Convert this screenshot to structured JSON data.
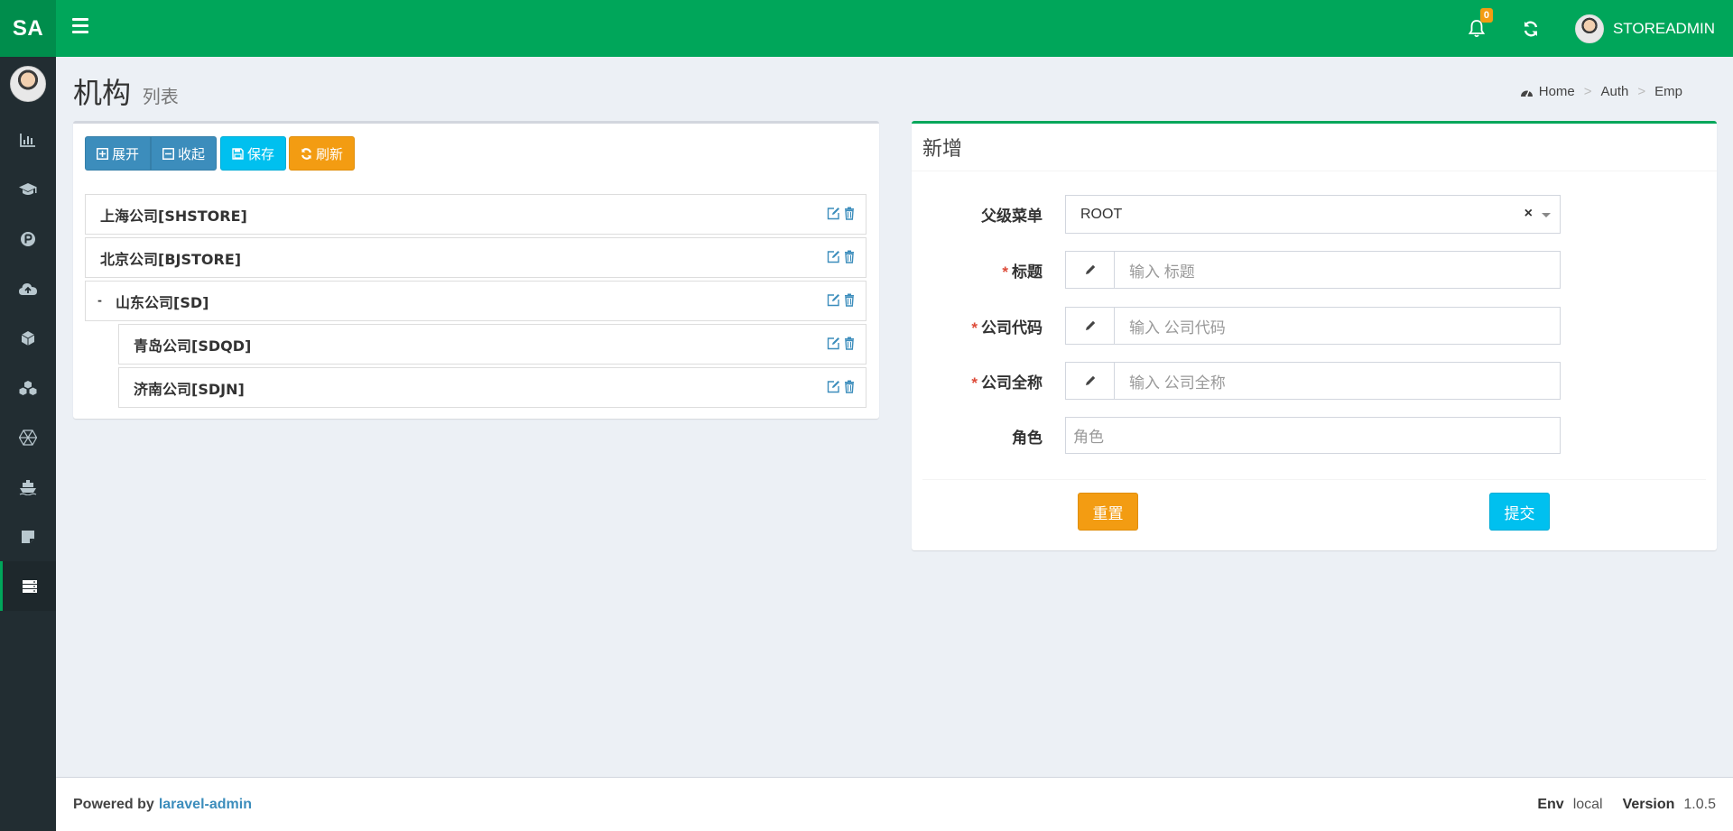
{
  "header": {
    "logo": "SA",
    "notification_count": "0",
    "user_name": "STOREADMIN"
  },
  "sidebar": {
    "icons": [
      "bar-chart-icon",
      "graduation-cap-icon",
      "product-hunt-icon",
      "cloud-upload-icon",
      "cube-icon",
      "cubes-icon",
      "connectdevelop-icon",
      "ship-icon",
      "sticky-note-icon",
      "server-icon"
    ],
    "active_index": 9
  },
  "page": {
    "title": "机构",
    "subtitle": "列表",
    "breadcrumb": [
      "Home",
      "Auth",
      "Emp"
    ],
    "breadcrumb_sep": ">"
  },
  "toolbar": {
    "expand_label": "展开",
    "collapse_label": "收起",
    "save_label": "保存",
    "refresh_label": "刷新"
  },
  "tree": {
    "items": [
      {
        "label": "上海公司[SHSTORE]",
        "level": 0
      },
      {
        "label": "北京公司[BJSTORE]",
        "level": 0
      },
      {
        "label": "山东公司[SD]",
        "level": 0,
        "collapse_marker": "-"
      },
      {
        "label": "青岛公司[SDQD]",
        "level": 1
      },
      {
        "label": "济南公司[SDJN]",
        "level": 1
      }
    ]
  },
  "form": {
    "title": "新增",
    "parent_label": "父级菜单",
    "parent_value": "ROOT",
    "clear_symbol": "×",
    "title_label": "标题",
    "title_placeholder": "输入 标题",
    "code_label": "公司代码",
    "code_placeholder": "输入 公司代码",
    "fullname_label": "公司全称",
    "fullname_placeholder": "输入 公司全称",
    "role_label": "角色",
    "role_placeholder": "角色",
    "required_mark": "*",
    "reset_label": "重置",
    "submit_label": "提交"
  },
  "footer": {
    "powered_by": "Powered by",
    "link": "laravel-admin",
    "env_key": "Env",
    "env_value": "local",
    "version_key": "Version",
    "version_value": "1.0.5"
  },
  "colors": {
    "header_green": "#00a65a",
    "logo_green": "#008d4c",
    "sidebar_dark": "#222d32",
    "primary": "#3c8dbc",
    "info": "#00c0ef",
    "warning": "#f39c12"
  }
}
